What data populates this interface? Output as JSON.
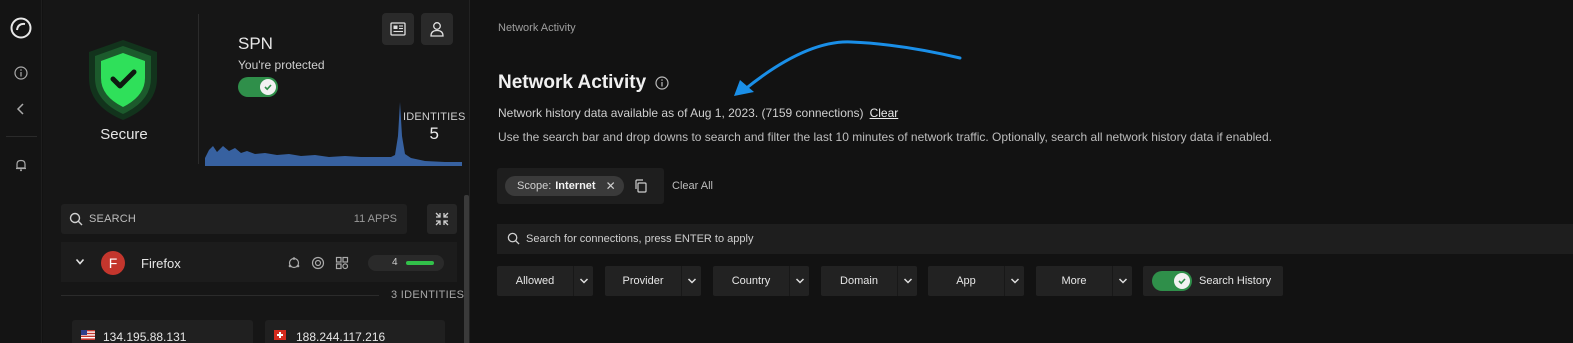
{
  "sidebar": {
    "icons": [
      "logo-icon",
      "info-icon",
      "chevron-left-icon",
      "bell-icon"
    ]
  },
  "status": {
    "label": "Secure",
    "shield_color": "#2fe05a"
  },
  "spn": {
    "title": "SPN",
    "subtitle": "You're protected",
    "toggle_on": true
  },
  "identities": {
    "label": "IDENTITIES",
    "count": "5"
  },
  "app_search": {
    "placeholder": "SEARCH",
    "count": "11 APPS"
  },
  "app_row": {
    "avatar_letter": "F",
    "name": "Firefox",
    "badge_count": "4",
    "identities": "3 IDENTITIES"
  },
  "ip_cards": [
    {
      "flag": "us",
      "ip": "134.195.88.131"
    },
    {
      "flag": "ch",
      "ip": "188.244.117.216"
    }
  ],
  "main": {
    "breadcrumb": "Network Activity",
    "title": "Network Activity",
    "history_text": "Network history data available as of Aug 1, 2023. (7159 connections)",
    "clear_label": "Clear",
    "help_text": "Use the search bar and drop downs to search and filter the last 10 minutes of network traffic. Optionally, search all network history data if enabled.",
    "scope_key": "Scope:",
    "scope_value": "Internet",
    "clear_all": "Clear All",
    "search_placeholder": "Search for connections, press ENTER to apply",
    "filters": [
      "Allowed",
      "Provider",
      "Country",
      "Domain",
      "App",
      "More"
    ],
    "search_history_label": "Search History",
    "search_history_on": true
  },
  "colors": {
    "accent_green": "#2f8f4a",
    "badge_green": "#32c14a",
    "chart_blue": "#3d6fb8",
    "annotation_arrow": "#1a8fe8"
  }
}
